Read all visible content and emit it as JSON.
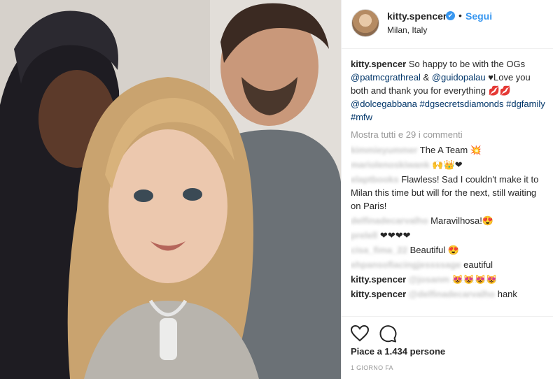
{
  "post": {
    "username": "kitty.spencer",
    "verified_badge": "✔",
    "separator": "•",
    "follow_label": "Segui",
    "location": "Milan, Italy",
    "photo_description_icon": "photo"
  },
  "caption": {
    "username": "kitty.spencer",
    "text_1": "So happy to be with the OGs",
    "mention_1": "@patmcgrathreal",
    "amp": "&",
    "mention_2": "@guidopalau",
    "text_2": "♥Love you both and thank you for everything 💋💋",
    "mention_3": "@dolcegabbana",
    "hashtag_1": "#dgsecretsdiamonds",
    "hashtag_2": "#dgfamily",
    "hashtag_3": "#mfw"
  },
  "view_all": "Mostra tutti e 29 i commenti",
  "comments": [
    {
      "user": "kimmieyummer",
      "text": "The A Team 💥"
    },
    {
      "user": "mariolenoskiwank",
      "text": "🙌👑❤"
    },
    {
      "user": "elaptbooks",
      "text": "Flawless! Sad I couldn't make it to Milan this time but will for the next, still waiting on Paris!"
    },
    {
      "user": "delfinadecarvalho",
      "text": "Maravilhosa!😍"
    },
    {
      "user": "prelell",
      "text": "❤❤❤❤"
    },
    {
      "user": "cisa_fima_22",
      "text": "Beautiful 😍"
    },
    {
      "user": "ehpansofiacingjessssage",
      "text": "eautiful"
    },
    {
      "user": "kitty.spencer",
      "mention": "@josanm",
      "text": "😻😻😻😻"
    },
    {
      "user": "kitty.spencer",
      "mention": "@delfinadecarvalho",
      "text": "hank"
    }
  ],
  "actions": {
    "like_icon": "heart-icon",
    "comment_icon": "comment-icon",
    "likes_text": "Piace a 1.434 persone",
    "time_ago": "1 GIORNO FA"
  }
}
